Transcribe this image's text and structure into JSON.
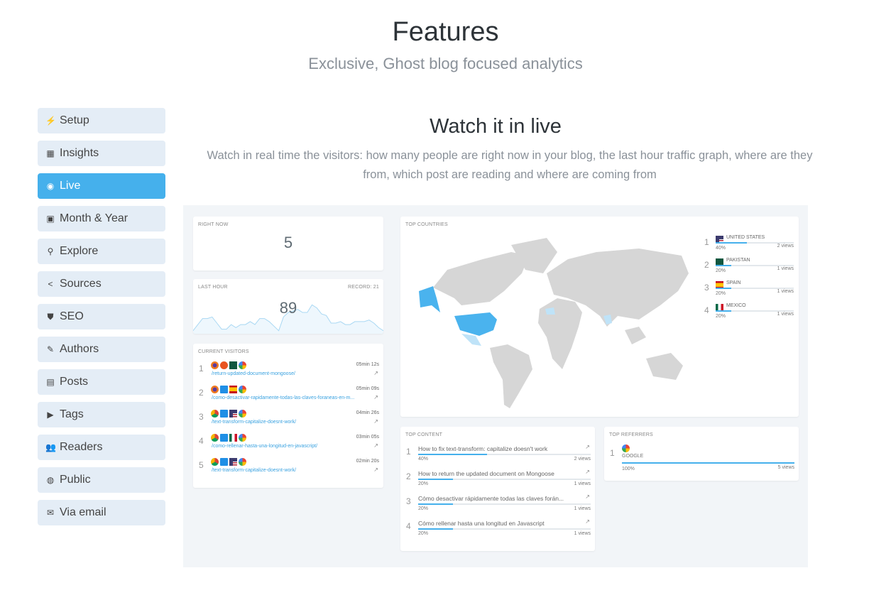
{
  "header": {
    "title": "Features",
    "subtitle": "Exclusive, Ghost blog focused analytics"
  },
  "sidebar": {
    "items": [
      {
        "label": "Setup",
        "icon": "bolt-icon",
        "glyph": "⚡"
      },
      {
        "label": "Insights",
        "icon": "dashboard-icon",
        "glyph": "▦"
      },
      {
        "label": "Live",
        "icon": "radio-button-icon",
        "glyph": "◉",
        "active": true
      },
      {
        "label": "Month & Year",
        "icon": "calendar-icon",
        "glyph": "▣"
      },
      {
        "label": "Explore",
        "icon": "search-icon",
        "glyph": "⚲"
      },
      {
        "label": "Sources",
        "icon": "share-icon",
        "glyph": "<"
      },
      {
        "label": "SEO",
        "icon": "shield-icon",
        "glyph": "⛊"
      },
      {
        "label": "Authors",
        "icon": "pencil-icon",
        "glyph": "✎"
      },
      {
        "label": "Posts",
        "icon": "document-icon",
        "glyph": "▤"
      },
      {
        "label": "Tags",
        "icon": "tag-icon",
        "glyph": "▶"
      },
      {
        "label": "Readers",
        "icon": "people-icon",
        "glyph": "👥"
      },
      {
        "label": "Public",
        "icon": "globe-icon",
        "glyph": "◍"
      },
      {
        "label": "Via email",
        "icon": "mail-icon",
        "glyph": "✉"
      }
    ]
  },
  "section": {
    "title": "Watch it in live",
    "description": "Watch in real time the visitors: how many people are right now in your blog, the last hour traffic graph, where are they from, which post are reading and where are coming from"
  },
  "colors": {
    "accent": "#45b0ec",
    "map_land": "#d6d6d6",
    "map_highlight": "#4ab3ee",
    "map_light": "#bfe3f8"
  },
  "right_now": {
    "label": "RIGHT NOW",
    "value": "5"
  },
  "last_hour": {
    "label": "LAST HOUR",
    "record": "RECORD:  21",
    "value": "89",
    "series": [
      2,
      6,
      10,
      10,
      11,
      7,
      3,
      3,
      6,
      4,
      6,
      6,
      8,
      6,
      10,
      10,
      8,
      5,
      2,
      11,
      14,
      15,
      16,
      14,
      14,
      19,
      17,
      13,
      12,
      7,
      7,
      8,
      6,
      6,
      8,
      8,
      8,
      9,
      7,
      4,
      2
    ]
  },
  "current_visitors": {
    "label": "CURRENT VISITORS",
    "items": [
      {
        "rank": "1",
        "icons": [
          "firefox",
          "ubuntu",
          "flag-pakistan",
          "google"
        ],
        "time": "05min 12s",
        "path": "/return-updated-document-mongoose/"
      },
      {
        "rank": "2",
        "icons": [
          "firefox",
          "windows",
          "flag-spain",
          "google"
        ],
        "time": "05min 09s",
        "path": "/como-desactivar-rapidamente-todas-las-claves-foraneas-en-m..."
      },
      {
        "rank": "3",
        "icons": [
          "chrome",
          "windows",
          "flag-usa",
          "google"
        ],
        "time": "04min 26s",
        "path": "/text-transform-capitalize-doesnt-work/"
      },
      {
        "rank": "4",
        "icons": [
          "chrome",
          "windows",
          "flag-mexico",
          "google"
        ],
        "time": "03min 05s",
        "path": "/como-rellenar-hasta-una-longitud-en-javascript/"
      },
      {
        "rank": "5",
        "icons": [
          "chrome",
          "windows",
          "flag-usa",
          "google"
        ],
        "time": "02min 20s",
        "path": "/text-transform-capitalize-doesnt-work/"
      }
    ]
  },
  "top_countries": {
    "label": "TOP COUNTRIES",
    "items": [
      {
        "rank": "1",
        "name": "UNITED STATES",
        "flag": "flag-usa",
        "percent": "40%",
        "pct": 40,
        "views": "2 views"
      },
      {
        "rank": "2",
        "name": "PAKISTAN",
        "flag": "flag-pakistan",
        "percent": "20%",
        "pct": 20,
        "views": "1 views"
      },
      {
        "rank": "3",
        "name": "SPAIN",
        "flag": "flag-spain",
        "percent": "20%",
        "pct": 20,
        "views": "1 views"
      },
      {
        "rank": "4",
        "name": "MEXICO",
        "flag": "flag-mexico",
        "percent": "20%",
        "pct": 20,
        "views": "1 views"
      }
    ]
  },
  "top_content": {
    "label": "TOP CONTENT",
    "items": [
      {
        "rank": "1",
        "title": "How to fix text-transform: capitalize doesn't work",
        "percent": "40%",
        "pct": 40,
        "views": "2  views"
      },
      {
        "rank": "2",
        "title": "How to return the updated document on Mongoose",
        "percent": "20%",
        "pct": 20,
        "views": "1  views"
      },
      {
        "rank": "3",
        "title": "Cómo desactivar rápidamente todas las claves forán...",
        "percent": "20%",
        "pct": 20,
        "views": "1  views"
      },
      {
        "rank": "4",
        "title": "Cómo rellenar hasta una longitud en Javascript",
        "percent": "20%",
        "pct": 20,
        "views": "1  views"
      }
    ]
  },
  "top_referrers": {
    "label": "TOP REFERRERS",
    "items": [
      {
        "rank": "1",
        "name": "GOOGLE",
        "icon": "google",
        "percent": "100%",
        "pct": 100,
        "views": "5 views"
      }
    ]
  }
}
